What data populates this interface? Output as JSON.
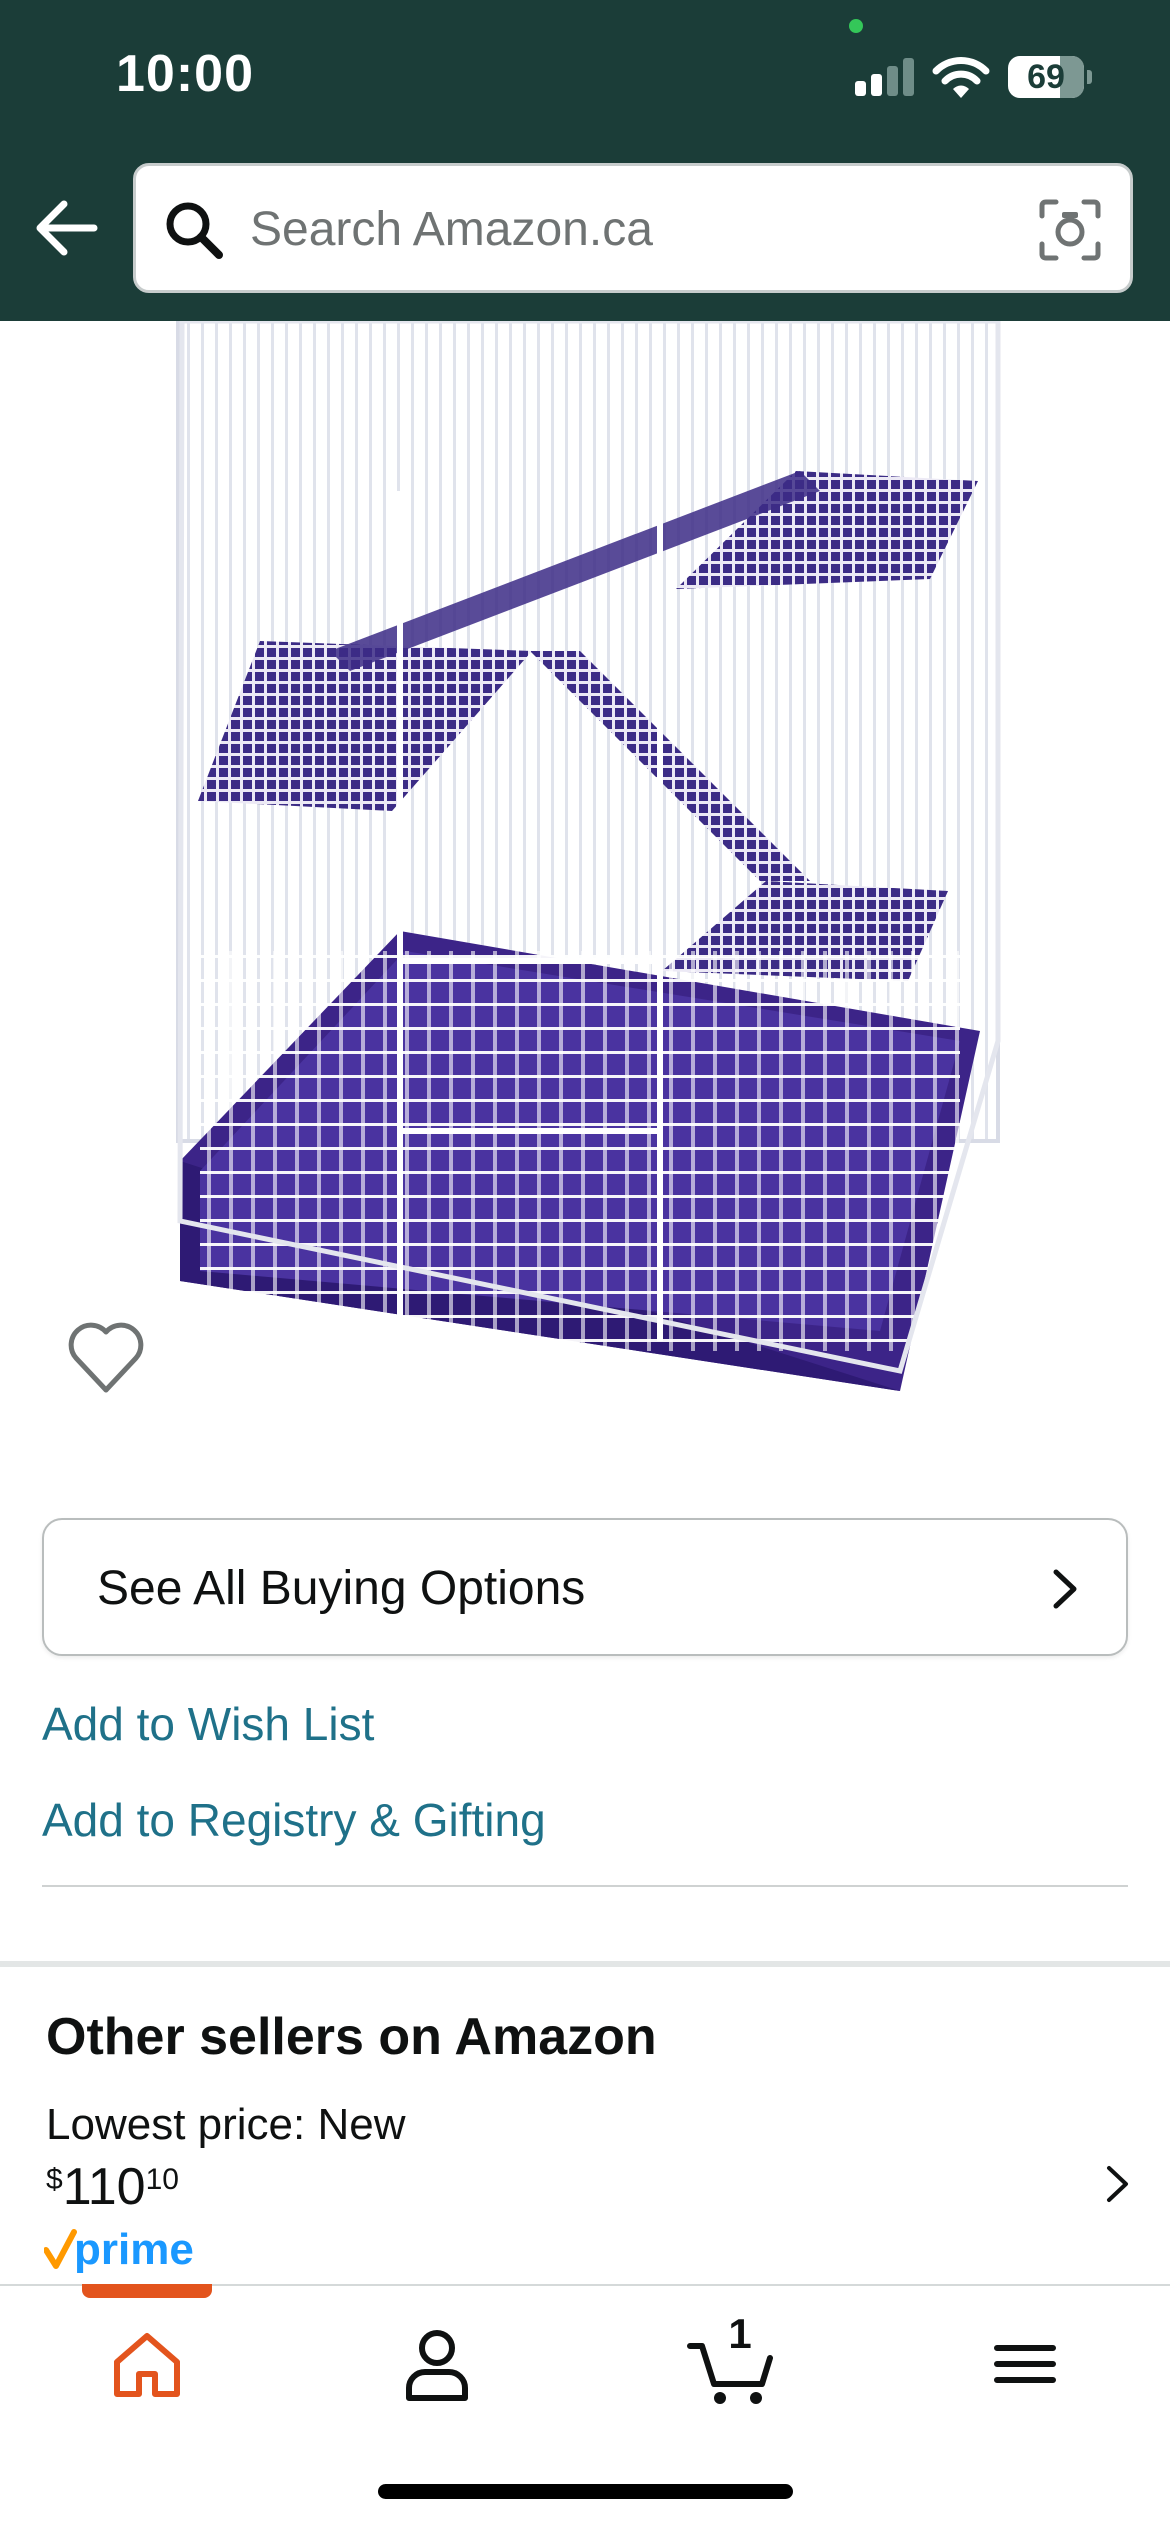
{
  "status_bar": {
    "time": "10:00",
    "battery_percent": "69"
  },
  "header": {
    "search": {
      "placeholder": "Search Amazon.ca",
      "value": ""
    },
    "icons": [
      "back-arrow-icon",
      "search-icon",
      "camera-icon"
    ]
  },
  "product": {
    "image": "product-image"
  },
  "actions": {
    "buying_options_label": "See All Buying Options",
    "wish_list_label": "Add to Wish List",
    "registry_label": "Add to Registry & Gifting"
  },
  "other_sellers": {
    "title": "Other sellers on Amazon",
    "lowest_price_label": "Lowest price: New",
    "price": {
      "symbol": "$",
      "whole": "110",
      "fraction": "10"
    },
    "badge": "prime"
  },
  "tabbar": {
    "tabs": [
      "home-tab",
      "account-tab",
      "cart-tab",
      "menu-tab"
    ],
    "active": "home-tab",
    "cart_count": "1"
  },
  "colors": {
    "header_bg": "#1b3d38",
    "link": "#1f7189",
    "accent": "#e3541d",
    "prime_blue": "#1a98ff",
    "prime_check": "#ff9900"
  }
}
